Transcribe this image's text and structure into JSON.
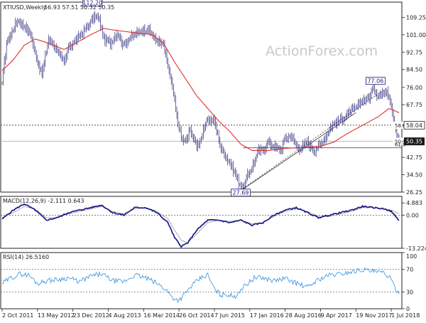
{
  "chart_data": [
    {
      "type": "candlestick",
      "title": "XTIUSD,Weekly",
      "ohlc_header": "56.93 57.51 50.32 50.35",
      "watermark": "ActionForex.com",
      "ylim": [
        26.25,
        116.5
      ],
      "y_ticks": [
        "109.25",
        "101.00",
        "92.75",
        "84.50",
        "76.00",
        "67.75",
        "58.04",
        "50.35",
        "42.75",
        "34.50",
        "26.25"
      ],
      "x_labels": [
        "2 Oct 2011",
        "13 May 2012",
        "23 Dec 2012",
        "4 Aug 2013",
        "16 Mar 2014",
        "26 Oct 2014",
        "7 Jun 2015",
        "17 Jan 2016",
        "28 Aug 2016",
        "9 Apr 2017",
        "19 Nov 2017",
        "1 Jul 2018"
      ],
      "annotations": [
        {
          "text": "112.20",
          "value": 112.2
        },
        {
          "text": "27.69",
          "value": 27.69
        },
        {
          "text": "77.06",
          "value": 77.06
        },
        {
          "text": "58.04",
          "value": 58.04
        },
        {
          "text": "50.35",
          "value": 50.35
        },
        {
          "text": "61.8",
          "value": 47.3
        }
      ],
      "series": [
        {
          "name": "Price",
          "color": "#2a2a7a",
          "anchors": [
            [
              0,
              78
            ],
            [
              4,
              97
            ],
            [
              14,
              108
            ],
            [
              22,
              104
            ],
            [
              26,
              101
            ],
            [
              30,
              92
            ],
            [
              36,
              82
            ],
            [
              42,
              99
            ],
            [
              50,
              94
            ],
            [
              56,
              87
            ],
            [
              60,
              95
            ],
            [
              66,
              98
            ],
            [
              76,
              104
            ],
            [
              84,
              110
            ],
            [
              88,
              108
            ],
            [
              92,
              99
            ],
            [
              98,
              97
            ],
            [
              104,
              102
            ],
            [
              110,
              96
            ],
            [
              114,
              99
            ],
            [
              120,
              101
            ],
            [
              126,
              103
            ],
            [
              132,
              104
            ],
            [
              138,
              99
            ],
            [
              146,
              96
            ],
            [
              150,
              86
            ],
            [
              154,
              76
            ],
            [
              158,
              62
            ],
            [
              162,
              52
            ],
            [
              166,
              50
            ],
            [
              170,
              56
            ],
            [
              176,
              48
            ],
            [
              180,
              52
            ],
            [
              186,
              61
            ],
            [
              192,
              60
            ],
            [
              198,
              47
            ],
            [
              204,
              42
            ],
            [
              210,
              36
            ],
            [
              214,
              31
            ],
            [
              218,
              28
            ],
            [
              222,
              34
            ],
            [
              226,
              38
            ],
            [
              232,
              46
            ],
            [
              236,
              46
            ],
            [
              240,
              50
            ],
            [
              246,
              48
            ],
            [
              252,
              46
            ],
            [
              256,
              52
            ],
            [
              262,
              53
            ],
            [
              266,
              48
            ],
            [
              270,
              47
            ],
            [
              276,
              50
            ],
            [
              282,
              46
            ],
            [
              288,
              49
            ],
            [
              292,
              52
            ],
            [
              298,
              58
            ],
            [
              304,
              60
            ],
            [
              310,
              62
            ],
            [
              316,
              65
            ],
            [
              320,
              66
            ],
            [
              326,
              70
            ],
            [
              332,
              71
            ],
            [
              336,
              76
            ],
            [
              340,
              72
            ],
            [
              344,
              73
            ],
            [
              348,
              75
            ],
            [
              352,
              68
            ],
            [
              354,
              62
            ],
            [
              356,
              55
            ],
            [
              359,
              50.35
            ]
          ]
        },
        {
          "name": "MA",
          "color": "#e03030",
          "anchors": [
            [
              0,
              84
            ],
            [
              10,
              89
            ],
            [
              20,
              96
            ],
            [
              30,
              99
            ],
            [
              42,
              97
            ],
            [
              56,
              94
            ],
            [
              70,
              98
            ],
            [
              80,
              101
            ],
            [
              92,
              104
            ],
            [
              104,
              103
            ],
            [
              120,
              102
            ],
            [
              136,
              101
            ],
            [
              146,
              97
            ],
            [
              156,
              88
            ],
            [
              166,
              80
            ],
            [
              176,
              72
            ],
            [
              186,
              66
            ],
            [
              196,
              60
            ],
            [
              206,
              55
            ],
            [
              216,
              49
            ],
            [
              226,
              46
            ],
            [
              240,
              46
            ],
            [
              256,
              47
            ],
            [
              272,
              47.5
            ],
            [
              288,
              48
            ],
            [
              300,
              50
            ],
            [
              312,
              54
            ],
            [
              326,
              58
            ],
            [
              340,
              62
            ],
            [
              350,
              66
            ],
            [
              359,
              64
            ]
          ]
        }
      ],
      "levels": [
        {
          "name": "58.04 line",
          "value": 58.04,
          "style": "dashed"
        },
        {
          "name": "50.35 line",
          "value": 50.35,
          "style": "solid"
        },
        {
          "name": "61.8 retracement",
          "value": 47.3,
          "style": "solid"
        }
      ]
    },
    {
      "type": "line",
      "title": "MACD(12,26,9) -2.111 0.643",
      "ylim": [
        -13.224,
        7.5
      ],
      "y_ticks": [
        "4.883",
        "0.00",
        "-13.224"
      ],
      "series": [
        {
          "name": "MACD",
          "color": "#1a1a8a",
          "anchors": [
            [
              0,
              -1.5
            ],
            [
              10,
              2
            ],
            [
              20,
              4.5
            ],
            [
              30,
              2
            ],
            [
              40,
              -2
            ],
            [
              50,
              -1
            ],
            [
              60,
              1
            ],
            [
              70,
              2
            ],
            [
              80,
              3
            ],
            [
              90,
              4
            ],
            [
              100,
              1
            ],
            [
              110,
              0
            ],
            [
              120,
              3
            ],
            [
              130,
              3
            ],
            [
              140,
              1
            ],
            [
              150,
              -3
            ],
            [
              156,
              -9
            ],
            [
              162,
              -12.5
            ],
            [
              168,
              -11
            ],
            [
              176,
              -6
            ],
            [
              186,
              -2
            ],
            [
              196,
              -2
            ],
            [
              206,
              -3
            ],
            [
              216,
              -2
            ],
            [
              226,
              -4
            ],
            [
              236,
              -3
            ],
            [
              246,
              0
            ],
            [
              256,
              2
            ],
            [
              266,
              3
            ],
            [
              276,
              1
            ],
            [
              286,
              -1
            ],
            [
              296,
              0
            ],
            [
              306,
              1
            ],
            [
              316,
              2
            ],
            [
              326,
              3.5
            ],
            [
              336,
              3
            ],
            [
              346,
              2.5
            ],
            [
              352,
              1.5
            ],
            [
              359,
              -2.1
            ]
          ]
        },
        {
          "name": "Signal",
          "color": "#999999",
          "anchors": [
            [
              0,
              -1
            ],
            [
              10,
              1
            ],
            [
              20,
              3.5
            ],
            [
              30,
              2.5
            ],
            [
              40,
              -1
            ],
            [
              50,
              -1
            ],
            [
              60,
              0.5
            ],
            [
              70,
              1.5
            ],
            [
              80,
              2.5
            ],
            [
              90,
              3.5
            ],
            [
              100,
              1.5
            ],
            [
              110,
              0.5
            ],
            [
              120,
              2.5
            ],
            [
              130,
              3
            ],
            [
              140,
              1.5
            ],
            [
              150,
              -1.5
            ],
            [
              156,
              -6
            ],
            [
              162,
              -10
            ],
            [
              168,
              -11
            ],
            [
              176,
              -7.5
            ],
            [
              186,
              -3
            ],
            [
              196,
              -2
            ],
            [
              206,
              -2.5
            ],
            [
              216,
              -2
            ],
            [
              226,
              -3.5
            ],
            [
              236,
              -3
            ],
            [
              246,
              -0.5
            ],
            [
              256,
              1.5
            ],
            [
              266,
              2.5
            ],
            [
              276,
              1.5
            ],
            [
              286,
              -0.5
            ],
            [
              296,
              -0.5
            ],
            [
              306,
              0.5
            ],
            [
              316,
              1.5
            ],
            [
              326,
              3
            ],
            [
              336,
              3
            ],
            [
              346,
              2.5
            ],
            [
              352,
              2
            ],
            [
              359,
              0.64
            ]
          ]
        }
      ],
      "levels": [
        {
          "name": "zero line",
          "value": 0
        }
      ]
    },
    {
      "type": "line",
      "title": "RSI(14) 26.5160",
      "ylim": [
        0,
        100
      ],
      "y_ticks": [
        "100",
        "70",
        "30",
        "0"
      ],
      "series": [
        {
          "name": "RSI",
          "color": "#2f8fe0",
          "anchors": [
            [
              0,
              45
            ],
            [
              8,
              55
            ],
            [
              16,
              62
            ],
            [
              24,
              60
            ],
            [
              32,
              45
            ],
            [
              40,
              50
            ],
            [
              50,
              52
            ],
            [
              60,
              55
            ],
            [
              70,
              48
            ],
            [
              80,
              58
            ],
            [
              90,
              62
            ],
            [
              100,
              50
            ],
            [
              110,
              48
            ],
            [
              120,
              60
            ],
            [
              130,
              55
            ],
            [
              140,
              45
            ],
            [
              148,
              35
            ],
            [
              154,
              20
            ],
            [
              160,
              15
            ],
            [
              166,
              28
            ],
            [
              172,
              42
            ],
            [
              180,
              55
            ],
            [
              186,
              60
            ],
            [
              192,
              35
            ],
            [
              198,
              24
            ],
            [
              204,
              26
            ],
            [
              210,
              20
            ],
            [
              216,
              35
            ],
            [
              222,
              45
            ],
            [
              228,
              55
            ],
            [
              236,
              55
            ],
            [
              246,
              50
            ],
            [
              256,
              54
            ],
            [
              266,
              46
            ],
            [
              276,
              38
            ],
            [
              286,
              52
            ],
            [
              296,
              60
            ],
            [
              306,
              62
            ],
            [
              316,
              66
            ],
            [
              326,
              70
            ],
            [
              336,
              66
            ],
            [
              344,
              64
            ],
            [
              350,
              58
            ],
            [
              354,
              42
            ],
            [
              359,
              26.5
            ]
          ]
        }
      ],
      "levels": [
        {
          "name": "rsi 70",
          "value": 70
        },
        {
          "name": "rsi 30",
          "value": 30
        }
      ]
    }
  ]
}
